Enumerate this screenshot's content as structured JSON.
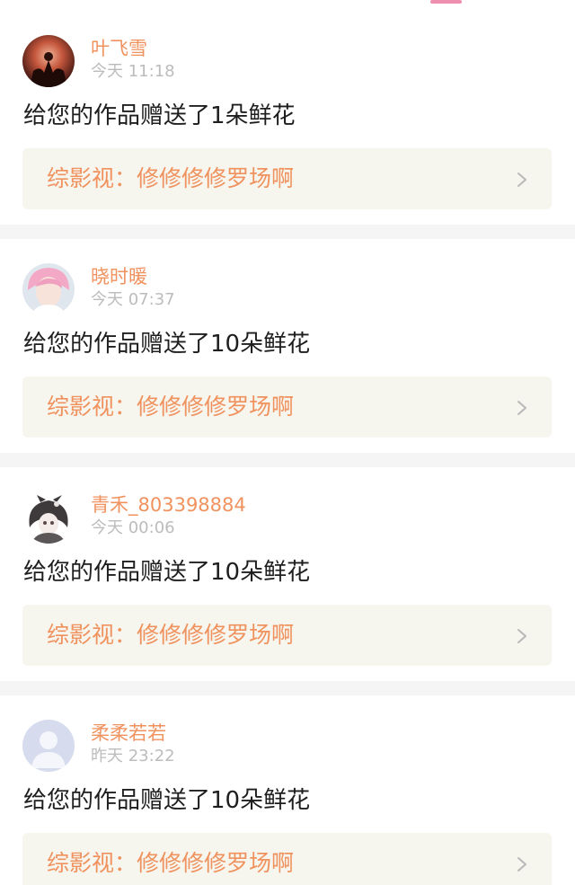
{
  "colors": {
    "accent": "#f0925e",
    "tab_indicator": "#ee8fb0",
    "timestamp": "#bcbcbc",
    "link_bg": "#f6f5ee",
    "separator": "#f5f5f5"
  },
  "notifications": [
    {
      "username": "叶飞雪",
      "time": "今天 11:18",
      "message": "给您的作品赠送了1朵鲜花",
      "work_title": "综影视：修修修修罗场啊",
      "avatar": "avatar-night-scene-icon"
    },
    {
      "username": "晓时暖",
      "time": "今天 07:37",
      "message": "给您的作品赠送了10朵鲜花",
      "work_title": "综影视：修修修修罗场啊",
      "avatar": "avatar-pink-hair-portrait-icon"
    },
    {
      "username": "青禾_803398884",
      "time": "今天 00:06",
      "message": "给您的作品赠送了10朵鲜花",
      "work_title": "综影视：修修修修罗场啊",
      "avatar": "avatar-anime-character-icon"
    },
    {
      "username": "柔柔若若",
      "time": "昨天 23:22",
      "message": "给您的作品赠送了10朵鲜花",
      "work_title": "综影视：修修修修罗场啊",
      "avatar": "avatar-default-user-icon"
    }
  ]
}
